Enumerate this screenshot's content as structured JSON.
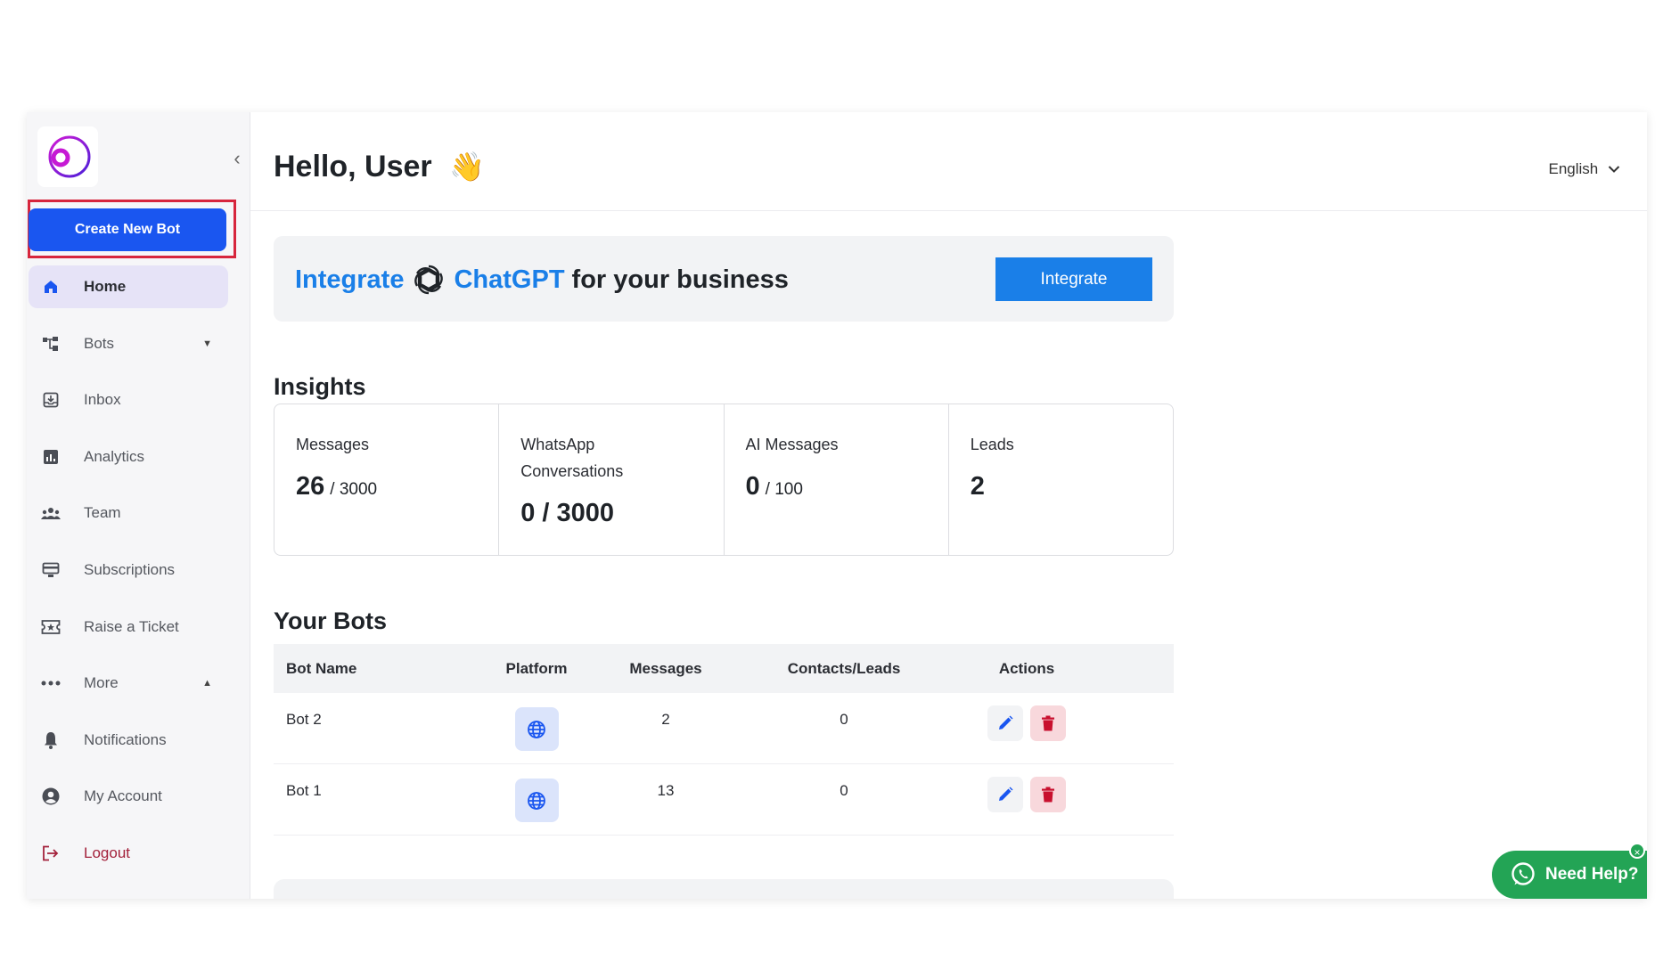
{
  "sidebar": {
    "create_button": "Create New Bot",
    "items": [
      {
        "label": "Home",
        "icon": "home-icon"
      },
      {
        "label": "Bots",
        "icon": "bots-icon"
      },
      {
        "label": "Inbox",
        "icon": "inbox-icon"
      },
      {
        "label": "Analytics",
        "icon": "analytics-icon"
      },
      {
        "label": "Team",
        "icon": "team-icon"
      },
      {
        "label": "Subscriptions",
        "icon": "subscriptions-icon"
      },
      {
        "label": "Raise a Ticket",
        "icon": "ticket-icon"
      },
      {
        "label": "More",
        "icon": "more-icon"
      },
      {
        "label": "Notifications",
        "icon": "bell-icon"
      },
      {
        "label": "My Account",
        "icon": "account-icon"
      },
      {
        "label": "Logout",
        "icon": "logout-icon"
      }
    ]
  },
  "header": {
    "greeting": "Hello, User",
    "wave_emoji": "👋",
    "language": "English"
  },
  "banner": {
    "integrate_word": "Integrate",
    "brand": "ChatGPT",
    "rest": "for your business",
    "button": "Integrate"
  },
  "insights": {
    "title": "Insights",
    "cards": [
      {
        "label": "Messages",
        "value": "26",
        "limit": "/ 3000"
      },
      {
        "label": "WhatsApp Conversations",
        "value": "0 / 3000",
        "limit": ""
      },
      {
        "label": "AI Messages",
        "value": "0",
        "limit": "/ 100"
      },
      {
        "label": "Leads",
        "value": "2",
        "limit": ""
      }
    ]
  },
  "bots": {
    "title": "Your Bots",
    "columns": [
      "Bot Name",
      "Platform",
      "Messages",
      "Contacts/Leads",
      "Actions"
    ],
    "rows": [
      {
        "name": "Bot 2",
        "platform": "web",
        "messages": "2",
        "contacts": "0"
      },
      {
        "name": "Bot 1",
        "platform": "web",
        "messages": "13",
        "contacts": "0"
      }
    ]
  },
  "help": {
    "label": "Need Help?",
    "close": "×"
  },
  "colors": {
    "primary": "#1a56f0",
    "accent_blue": "#1a7fe8",
    "highlight_red": "#d7263d",
    "whatsapp_green": "#23a455"
  }
}
